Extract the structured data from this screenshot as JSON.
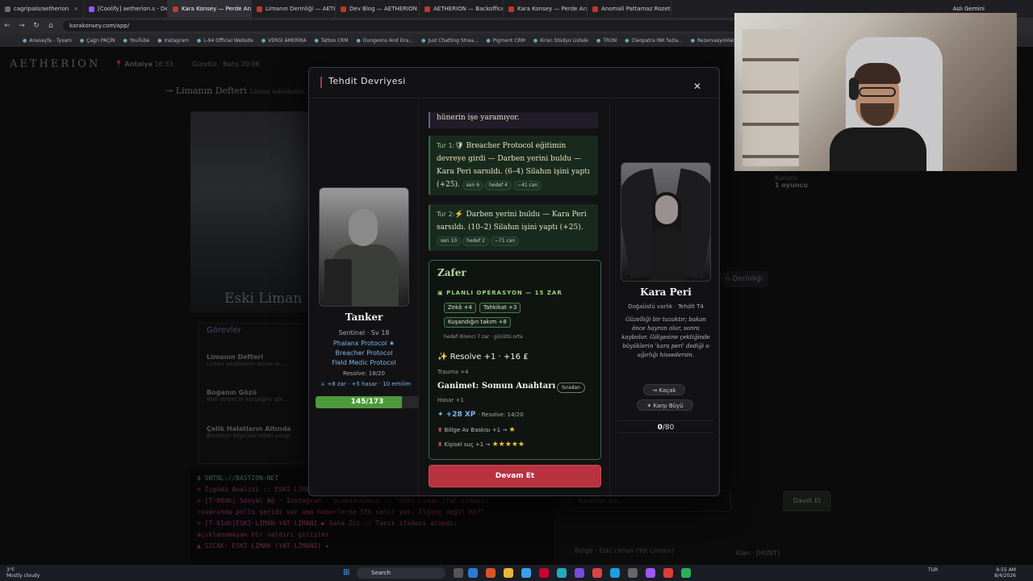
{
  "browser": {
    "tabs": [
      {
        "label": "cagripalo/aetherion",
        "color": "#6e6e6e"
      },
      {
        "label": "[Coolify] aetherion.s - Deploym",
        "color": "#8a5cf6"
      },
      {
        "label": "Kara Konsey — Perde Aralanıyo",
        "color": "#c0392b",
        "active": true
      },
      {
        "label": "Limanın Derinliği — AETHERION",
        "color": "#c0392b"
      },
      {
        "label": "Dev Blog — AETHERION",
        "color": "#c0392b"
      },
      {
        "label": "AETHERION — Backoffice",
        "color": "#c0392b"
      },
      {
        "label": "Kara Konsey — Perde Aralanıyo",
        "color": "#c0392b"
      },
      {
        "label": "Anomali Pattamaz Rozetleri Sl",
        "color": "#c0392b"
      }
    ],
    "profile": "Aslı Gemini",
    "url": "karakonsey.com/app/",
    "bookmarks": [
      "Anasayfa - Tysam",
      "Çağrı PAÇİN",
      "YouTube",
      "Instagram",
      "L-94 Official Website",
      "VERGİ AMERİKA",
      "Tattoo CRM",
      "Dungeons And Dra...",
      "Just Chatting Strea...",
      "Pigment CRM",
      "Kiran Stüdyo Listele",
      "TRON",
      "Cleopatra INK fazla...",
      "Rezervasyonlar | Cle..."
    ]
  },
  "background": {
    "logo": "AETHERION",
    "city": "Antalya",
    "time": "16:33",
    "day": "Gündüz · Bahş 20:06",
    "ledger_title": "→ Limanın Defteri",
    "ledger_sub": "Liman iskelesine...",
    "scene_title": "Eski Liman",
    "tasks_title": "Görevler",
    "tasks": [
      {
        "title": "Limanın Defteri",
        "sub": "Liman iskalesinin altına in..."
      },
      {
        "title": "Boğanın Gözü",
        "sub": "Wall street'in karşılığını gör..."
      },
      {
        "title": "Çelik Halatların Altında",
        "sub": "Brooklyn Köprüsü'ndeki yangı..."
      }
    ],
    "terminal_header": "$ SNTNL://BASTION-NET",
    "terminal_lines": [
      "> İçgüdü Analizi :: ESKİ LİMAN (YAT LİMANI) — Rakım yaklaşık [Şüphe 49%]",
      "> [T-00dk] Sosyal Ağ · Instagram · @camdankomsu :: \"Eski Liman (Yat Limanı)",
      "cıvarında polis şeridi var ama haberlerde TEK satır yok. İlginç değil mi?\"",
      "> [T-01dk]ESKİ-LİMAN-YAT-LİMANI ▶ Saha İzi :: Tanık ifadesi alındı:",
      "açıklanamayan bir saldırı girişimi.",
      "▲ SICAK: ESKİ LİMAN (YAT LİMANI) ★"
    ],
    "right_tab": "n Derinliği",
    "founding_label": "Kurucu",
    "founding_value": "1 oyuncu",
    "char_placeholder": "Karakter adı...",
    "next_button": "Davet Et",
    "region": "Bölge · Eski Liman (Yat Limanı)",
    "clan": "Klan · [HUNT]"
  },
  "modal": {
    "title": "Tehdit Devriyesi",
    "close_label": "✕",
    "player": {
      "name": "Tanker",
      "class": "Sentinel · Sv 18",
      "skills": [
        "Phalanx Protocol ★",
        "Breacher Protocol",
        "Field Medic Protocol"
      ],
      "resolve": "Resolve: 18/20",
      "stats": "⚔ +8 zar · +5 hasar · 10 emilim",
      "hp_current": 145,
      "hp_max": 173,
      "hp_text": "145/173"
    },
    "log": {
      "top_text": "hünerin işe yaramıyor.",
      "entries": [
        {
          "turn": "Tur 1:",
          "icon": "🛡",
          "text": "Breacher Protocol eğitimin devreye girdi — Darben yerini buldu — Kara Peri sarsıldı. (6–4) Silahın işini yaptı (+25).",
          "tags": [
            "sen 6",
            "hedef 4",
            "−41 can"
          ]
        },
        {
          "turn": "Tur 2:",
          "icon": "⚡",
          "text": "Darben yerini buldu — Kara Peri sarsıldı. (10–2) Silahın işini yaptı (+25).",
          "tags": [
            "sen 10",
            "hedef 2",
            "−71 can"
          ]
        }
      ]
    },
    "victory": {
      "title": "Zafer",
      "operation": "PLANLI OPERASYON — 15 ZAR",
      "chips": [
        "Zekâ +4",
        "Tahkikat +3",
        "Kuşandığın takım +8"
      ],
      "difficulty": "hedef direnci 7 zar · gürültü orta",
      "resolve": "✨ Resolve +1 · +16 ₤",
      "trauma": "Trauma +4",
      "loot": "Ganimet: Somun Anahtarı",
      "loot_rarity": "Sıradan",
      "damage": "Hasar +1",
      "xp": "✦ +28 XP",
      "xp_resolve": "· Resolve: 14/20",
      "rep_region": "Bölge Av Baskısı +1 →",
      "rep_region_stars": 1,
      "rep_personal": "Kişisel suç +1 →",
      "rep_personal_stars": 5
    },
    "continue_label": "Devam Et",
    "enemy": {
      "name": "Kara Peri",
      "class": "Doğaüstü varlık · Tehdit T4",
      "description": "Güzelliği bir tuzaktır; bakan önce hayran olur, sonra kaybolur. Gölgesine çektiğinde büyüklerin 'kara peri' dediği o ağırlığı hissedersin.",
      "tags": [
        "⇝ Kaçak",
        "✶ Karşı Büyü"
      ],
      "hp_current": "0",
      "hp_max": "/80"
    }
  },
  "taskbar": {
    "weather_temp": "3°F",
    "weather_desc": "Mostly cloudy",
    "search": "Search",
    "lang": "TUR",
    "time": "9:55 AM",
    "date": "8/4/2026"
  }
}
